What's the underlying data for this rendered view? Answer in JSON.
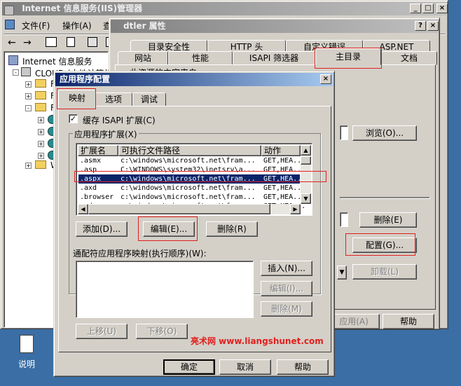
{
  "iis_window": {
    "title": "Internet 信息服务(IIS)管理器",
    "menu": [
      "文件(F)",
      "操作(A)",
      "查"
    ],
    "tree": {
      "root": "Internet 信息服务",
      "server": "CLOUD (本地计算机)",
      "folder_letters": [
        "F",
        "F",
        "F"
      ],
      "web_letter": "W"
    }
  },
  "props_dialog": {
    "title": "dtler 属性",
    "tabs_row1": [
      "目录安全性",
      "HTTP 头",
      "自定义错误",
      "ASP.NET"
    ],
    "tabs_row2": [
      "网站",
      "性能",
      "ISAPI 筛选器",
      "主目录",
      "文档"
    ],
    "partial_text": "此资源的内容来自:",
    "browse": "浏览(O)...",
    "remove": "删除(E)",
    "config": "配置(G)...",
    "unload": "卸载(L)",
    "apply": "应用(A)",
    "help": "帮助"
  },
  "app_config": {
    "title": "应用程序配置",
    "tabs": [
      "映射",
      "选项",
      "调试"
    ],
    "cache_checkbox": "缓存 ISAPI 扩展(C)",
    "extensions_label": "应用程序扩展(X)",
    "columns": [
      "扩展名",
      "可执行文件路径",
      "动作"
    ],
    "rows": [
      {
        "ext": ".asmx",
        "path": "c:\\windows\\microsoft.net\\fram...",
        "verbs": "GET,HEA..."
      },
      {
        "ext": ".asp",
        "path": "C:\\WINDOWS\\system32\\inetsrv\\a...",
        "verbs": "GET,HEA..."
      },
      {
        "ext": ".aspx",
        "path": "c:\\windows\\microsoft.net\\fram...",
        "verbs": "GET,HEA..."
      },
      {
        "ext": ".axd",
        "path": "c:\\windows\\microsoft.net\\fram...",
        "verbs": "GET,HEA..."
      },
      {
        "ext": ".browser",
        "path": "c:\\windows\\microsoft.net\\fram...",
        "verbs": "GET,HEA..."
      },
      {
        "ext": ".cd",
        "path": "c:\\windows\\microsoft.net\\fram...",
        "verbs": "GET,HEA..."
      }
    ],
    "add": "添加(D)...",
    "edit": "编辑(E)...",
    "remove": "删除(R)",
    "wildcard_label": "通配符应用程序映射(执行顺序)(W):",
    "insert": "插入(N)...",
    "edit2": "编辑(I)...",
    "remove2": "删除(M)",
    "move_up": "上移(U)",
    "move_down": "下移(O)",
    "ok": "确定",
    "cancel": "取消",
    "help": "帮助"
  },
  "desktop_icon": "说明",
  "watermark": "亮术网 www.liangshunet.com",
  "colors": {
    "highlight": "#0a246a",
    "annotation": "#e0201e",
    "watermark": "#e0201e"
  }
}
